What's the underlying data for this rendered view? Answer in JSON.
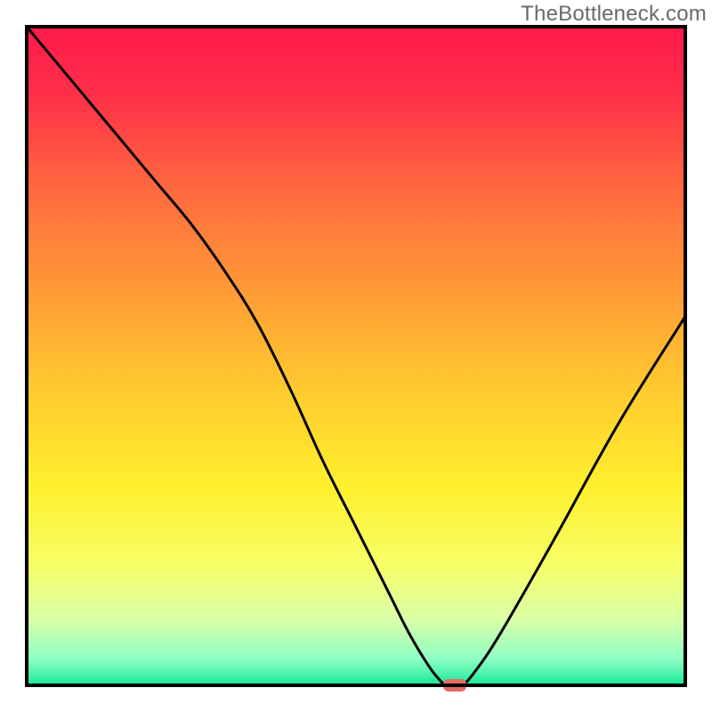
{
  "watermark": "TheBottleneck.com",
  "chart_data": {
    "type": "line",
    "title": "",
    "xlabel": "",
    "ylabel": "",
    "xlim": [
      0,
      100
    ],
    "ylim": [
      0,
      100
    ],
    "axes_visible": false,
    "grid": false,
    "background_gradient": {
      "stops": [
        {
          "offset": 0.0,
          "color": "#ff1a4b"
        },
        {
          "offset": 0.1,
          "color": "#ff2f49"
        },
        {
          "offset": 0.25,
          "color": "#ff6a3f"
        },
        {
          "offset": 0.4,
          "color": "#ff9a36"
        },
        {
          "offset": 0.55,
          "color": "#ffca2f"
        },
        {
          "offset": 0.7,
          "color": "#fff02e"
        },
        {
          "offset": 0.82,
          "color": "#f6ff6a"
        },
        {
          "offset": 0.9,
          "color": "#d9ffa8"
        },
        {
          "offset": 0.96,
          "color": "#8effc4"
        },
        {
          "offset": 1.0,
          "color": "#17e898"
        }
      ]
    },
    "curve": {
      "description": "V-shaped bottleneck curve with minimum near x≈65; left arm from top-left, right arm rising to ~55% height at right edge; short flat plateau at the minimum.",
      "x": [
        0,
        5,
        10,
        15,
        20,
        25,
        30,
        35,
        40,
        45,
        50,
        55,
        58,
        61,
        63,
        64,
        66,
        68,
        72,
        80,
        90,
        100
      ],
      "y": [
        100,
        94,
        88,
        82,
        76,
        70,
        63,
        55,
        45,
        34,
        24,
        14,
        8,
        3,
        0.5,
        0,
        0,
        2,
        8,
        22,
        40,
        56
      ]
    },
    "optimal_marker": {
      "x": 65,
      "y": 0,
      "shape": "rounded-rect",
      "color": "#e56a63"
    },
    "plot_border": true
  }
}
